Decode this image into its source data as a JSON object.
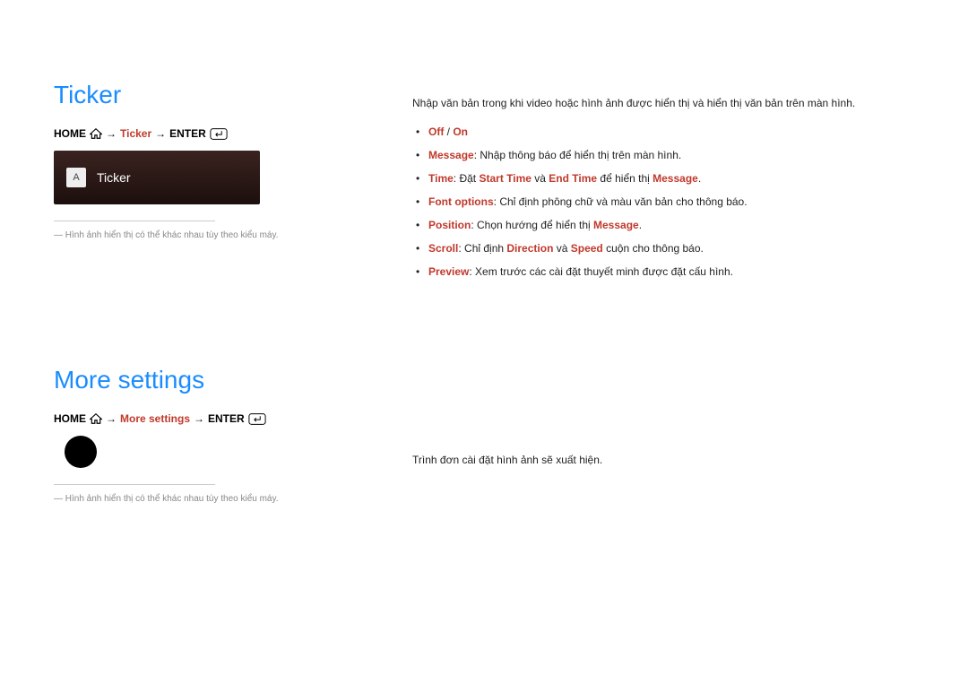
{
  "section1": {
    "title": "Ticker",
    "breadcrumb": {
      "home": "HOME",
      "mid": "Ticker",
      "enter": "ENTER"
    },
    "card": {
      "badge": "A",
      "label": "Ticker"
    },
    "note": "Hình ảnh hiển thị có thể khác nhau tùy theo kiểu máy."
  },
  "section2": {
    "title": "More settings",
    "breadcrumb": {
      "home": "HOME",
      "mid": "More settings",
      "enter": "ENTER"
    },
    "note": "Hình ảnh hiển thị có thể khác nhau tùy theo kiểu máy."
  },
  "right1": {
    "intro": "Nhập văn bản trong khi video hoặc hình ảnh được hiển thị và hiển thị văn bản trên màn hình.",
    "items": [
      {
        "hl1": "Off",
        "sep": " / ",
        "hl2": "On",
        "rest": ""
      },
      {
        "hl1": "Message",
        "rest": ": Nhập thông báo để hiển thị trên màn hình."
      },
      {
        "hl1": "Time",
        "t1": ": Đặt ",
        "hl2": "Start Time",
        "t2": " và ",
        "hl3": "End Time",
        "t3": " để hiển thị ",
        "hl4": "Message",
        "t4": "."
      },
      {
        "hl1": "Font options",
        "rest": ": Chỉ định phông chữ và màu văn bản cho thông báo."
      },
      {
        "hl1": "Position",
        "t1": ": Chọn hướng để hiển thị ",
        "hl2": "Message",
        "t2": "."
      },
      {
        "hl1": "Scroll",
        "t1": ": Chỉ định ",
        "hl2": "Direction",
        "t2": " và ",
        "hl3": "Speed",
        "t3": " cuộn cho thông báo."
      },
      {
        "hl1": "Preview",
        "rest": ": Xem trước các cài đặt thuyết minh được đặt cấu hình."
      }
    ]
  },
  "right2": {
    "intro": "Trình đơn cài đặt hình ảnh sẽ xuất hiện."
  }
}
